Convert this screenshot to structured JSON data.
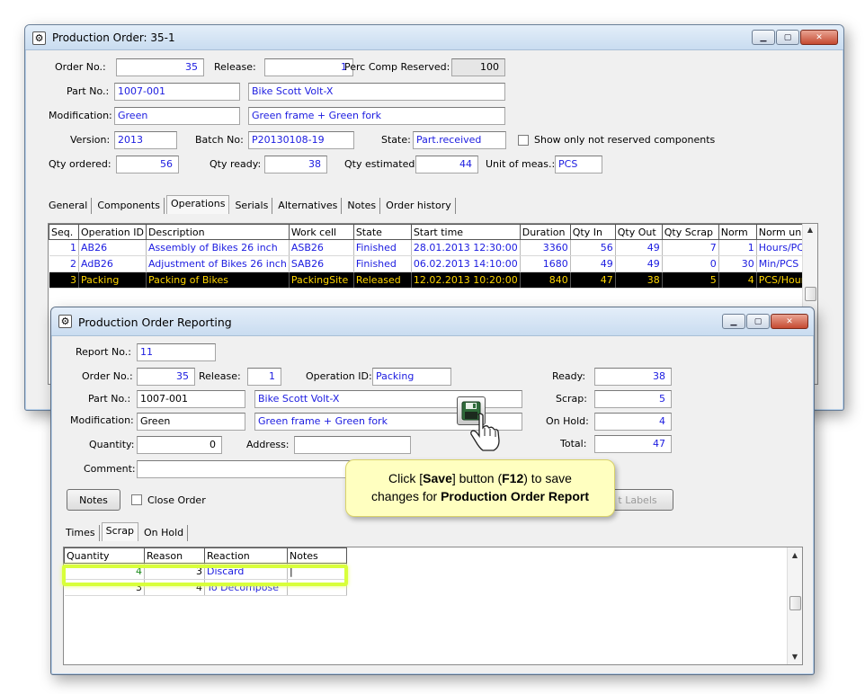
{
  "order_window": {
    "title": "Production Order: 35-1",
    "fields": {
      "order_no_label": "Order No.:",
      "order_no": "35",
      "release_label": "Release:",
      "release": "1",
      "perc_comp_label": "Perc Comp Reserved:",
      "perc_comp": "100",
      "part_no_label": "Part No.:",
      "part_no": "1007-001",
      "part_desc": "Bike Scott Volt-X",
      "modification_label": "Modification:",
      "modification": "Green",
      "modification_desc": "Green frame + Green fork",
      "version_label": "Version:",
      "version": "2013",
      "batch_label": "Batch No:",
      "batch": "P20130108-19",
      "state_label": "State:",
      "state": "Part.received",
      "show_only_label": "Show only not reserved components",
      "qty_ordered_label": "Qty ordered:",
      "qty_ordered": "56",
      "qty_ready_label": "Qty ready:",
      "qty_ready": "38",
      "qty_estimated_label": "Qty estimated:",
      "qty_estimated": "44",
      "unit_label": "Unit of meas.:",
      "unit": "PCS"
    },
    "tabs": [
      "General",
      "Components",
      "Operations",
      "Serials",
      "Alternatives",
      "Notes",
      "Order history"
    ],
    "active_tab": "Operations",
    "ops_columns": [
      "Seq.",
      "Operation ID",
      "Description",
      "Work cell",
      "State",
      "Start time",
      "Duration",
      "Qty In",
      "Qty Out",
      "Qty Scrap",
      "Norm",
      "Norm unit"
    ],
    "ops_rows": [
      [
        "1",
        "AB26",
        "Assembly of Bikes 26 inch",
        "ASB26",
        "Finished",
        "28.01.2013 12:30:00",
        "3360",
        "56",
        "49",
        "7",
        "1",
        "Hours/PCS"
      ],
      [
        "2",
        "AdB26",
        "Adjustment of Bikes 26 inch",
        "SAB26",
        "Finished",
        "06.02.2013 14:10:00",
        "1680",
        "49",
        "49",
        "0",
        "30",
        "Min/PCS"
      ],
      [
        "3",
        "Packing",
        "Packing of Bikes",
        "PackingSite",
        "Released",
        "12.02.2013 10:20:00",
        "840",
        "47",
        "38",
        "5",
        "4",
        "PCS/Hour"
      ]
    ]
  },
  "report_window": {
    "title": "Production Order Reporting",
    "report_no_label": "Report No.:",
    "report_no": "11",
    "order_no_label": "Order No.:",
    "order_no": "35",
    "release_label": "Release:",
    "release": "1",
    "operation_id_label": "Operation ID:",
    "operation_id": "Packing",
    "part_no_label": "Part No.:",
    "part_no": "1007-001",
    "part_desc": "Bike Scott Volt-X",
    "modification_label": "Modification:",
    "modification": "Green",
    "modification_desc": "Green frame + Green fork",
    "quantity_label": "Quantity:",
    "quantity": "0",
    "address_label": "Address:",
    "address": "",
    "comment_label": "Comment:",
    "comment": "",
    "ready_label": "Ready:",
    "ready": "38",
    "scrap_label": "Scrap:",
    "scrap": "5",
    "on_hold_label": "On Hold:",
    "on_hold": "4",
    "total_label": "Total:",
    "total": "47",
    "notes_button": "Notes",
    "close_order_label": "Close Order",
    "labels_button": "t Labels",
    "tabs": [
      "Times",
      "Scrap",
      "On Hold"
    ],
    "active_tab": "Scrap",
    "scrap_columns": [
      "Quantity",
      "Reason",
      "Reaction",
      "Notes"
    ],
    "scrap_rows": [
      [
        "4",
        "3",
        "Discard",
        "|"
      ],
      [
        "3",
        "4",
        "To Decompose",
        ""
      ]
    ]
  },
  "callout": {
    "line1_prefix": "Click [",
    "line1_bold": "Save",
    "line1_mid": "] button (",
    "line1_key": "F12",
    "line1_suffix": ") to save",
    "line2_prefix": "changes for ",
    "line2_bold": "Production Order Report"
  },
  "colors": {
    "value_text": "#1b1be0",
    "selected_row_bg": "#000000",
    "selected_row_text": "#ffd600",
    "callout_bg": "#ffffc0",
    "highlight": "#d8ff3a"
  },
  "icons": {
    "window_icon": "gear-icon",
    "save_icon": "floppy-disk-icon",
    "cursor_icon": "hand-pointer-icon"
  }
}
